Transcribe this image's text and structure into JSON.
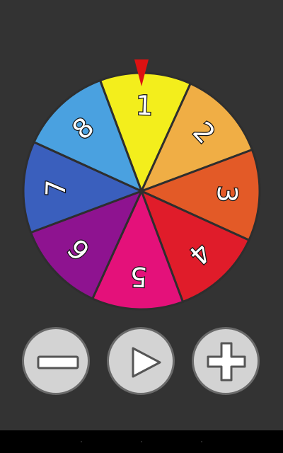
{
  "wheel": {
    "segments": [
      {
        "label": "1",
        "color": "#f3ee1c"
      },
      {
        "label": "2",
        "color": "#f0ae45"
      },
      {
        "label": "3",
        "color": "#e35a27"
      },
      {
        "label": "4",
        "color": "#e01c2a"
      },
      {
        "label": "5",
        "color": "#e4117a"
      },
      {
        "label": "6",
        "color": "#8e1390"
      },
      {
        "label": "7",
        "color": "#3a5fbd"
      },
      {
        "label": "8",
        "color": "#4aa1e0"
      }
    ],
    "pointer_color": "#dd1111",
    "divider_color": "#2e2e2e"
  },
  "controls": {
    "minus": {
      "icon": "minus-icon"
    },
    "play": {
      "icon": "play-icon"
    },
    "plus": {
      "icon": "plus-icon"
    }
  },
  "colors": {
    "background": "#333333",
    "button_fill": "#d3d3d3",
    "button_border": "#6a6a6a",
    "icon_fill": "#ffffff",
    "icon_stroke": "#555555"
  }
}
